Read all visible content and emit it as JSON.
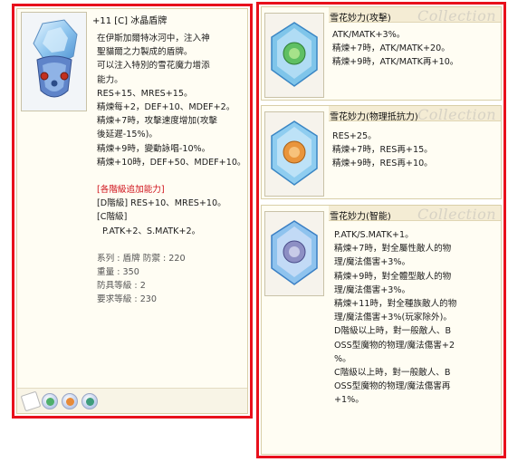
{
  "left_card": {
    "title": "+11 [C] 冰晶盾牌",
    "icon": "ice-crystal-shield-icon",
    "desc": [
      "在伊斯加爾特冰河中，注入神",
      "聖貓爾之力製成的盾牌。",
      "可以注入特別的雪花魔力增添",
      "能力。",
      "RES+15、MRES+15。",
      "精煉每+2，DEF+10、MDEF+2。",
      "精煉+7時，攻擊速度增加(攻擊",
      "後延遲-15%)。",
      "精煉+9時，變動詠唱-10%。",
      "精煉+10時，DEF+50、MDEF+10。"
    ],
    "grade_header": "[各階級追加能力]",
    "grade_lines": [
      "[D階級] RES+10、MRES+10。",
      "[C階級]",
      "P.ATK+2、S.MATK+2。"
    ],
    "stats": [
      "系列 : 盾牌  防禦 : 220",
      "重量 : 350",
      "防具等級 : 2",
      "要求等級 : 230"
    ],
    "slots": [
      "empty-slot-icon",
      "snowflake-attack-card-icon",
      "snowflake-resist-card-icon",
      "snowflake-intellect-card-icon"
    ]
  },
  "right_cards": [
    {
      "title": "雪花妙力(攻擊)",
      "watermark": "Collection",
      "icon": "green-snowflake-crystal-icon",
      "lines": [
        "ATK/MATK+3%。",
        "精煉+7時，ATK/MATK+20。",
        "精煉+9時，ATK/MATK再+10。"
      ]
    },
    {
      "title": "雪花妙力(物理抵抗力)",
      "watermark": "Collection",
      "icon": "orange-snowflake-crystal-icon",
      "lines": [
        "RES+25。",
        "精煉+7時，RES再+15。",
        "精煉+9時，RES再+10。"
      ]
    },
    {
      "title": "雪花妙力(智能)",
      "watermark": "Collection",
      "icon": "purple-snowflake-crystal-icon",
      "lines": [
        "P.ATK/S.MATK+1。",
        "精煉+7時，對全屬性敵人的物",
        "理/魔法傷害+3%。",
        "精煉+9時，對全體型敵人的物",
        "理/魔法傷害+3%。",
        "精煉+11時，對全種族敵人的物",
        "理/魔法傷害+3%(玩家除外)。",
        "D階級以上時，對一般敵人、B",
        "OSS型魔物的物理/魔法傷害+2",
        "%。",
        "C階級以上時，對一般敵人、B",
        "OSS型魔物的物理/魔法傷害再",
        "+1%。"
      ]
    }
  ],
  "colors": {
    "frame": "#e8101c",
    "grade_header": "#d0121b"
  }
}
